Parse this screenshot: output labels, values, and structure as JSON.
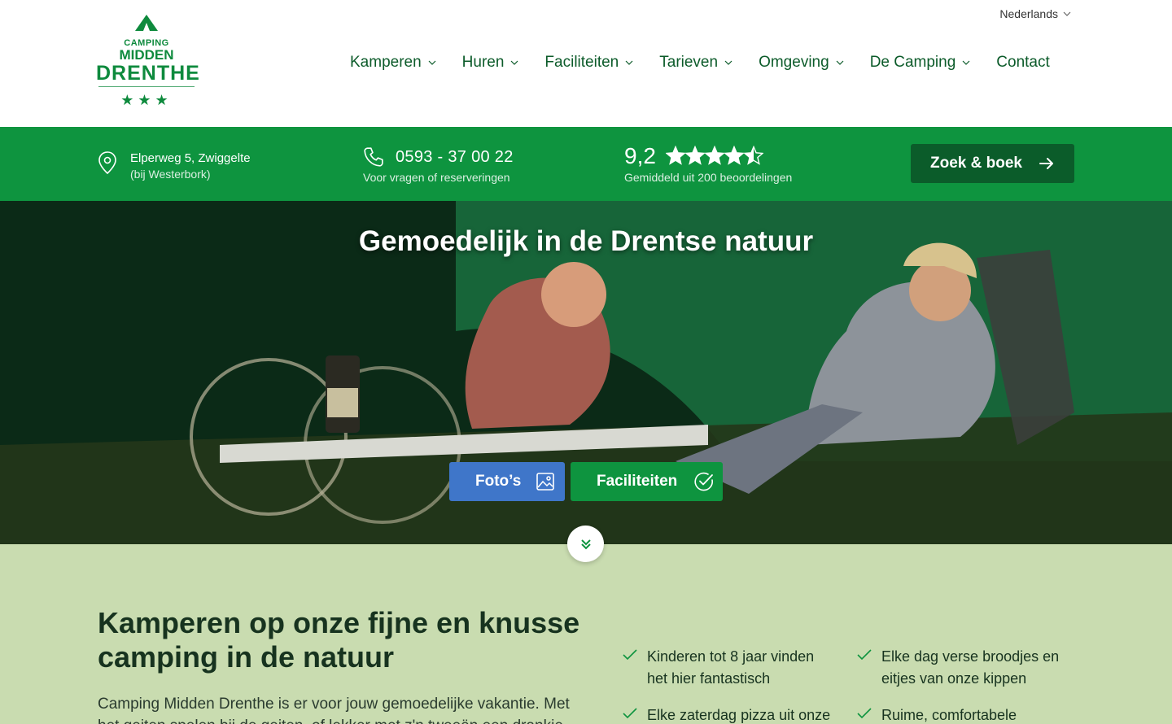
{
  "colors": {
    "brand_green": "#0e943f",
    "dark_green": "#0b5c2a",
    "photo_blue": "#3f76c9",
    "content_bg": "#c9dcb0"
  },
  "logo": {
    "line1": "CAMPING",
    "line2": "MIDDEN",
    "line3": "DRENTHE",
    "stars": "★★★"
  },
  "language": {
    "current": "Nederlands",
    "icon": "chevron-down-icon"
  },
  "nav": {
    "items": [
      {
        "label": "Kamperen",
        "dropdown": true
      },
      {
        "label": "Huren",
        "dropdown": true
      },
      {
        "label": "Faciliteiten",
        "dropdown": true
      },
      {
        "label": "Tarieven",
        "dropdown": true
      },
      {
        "label": "Omgeving",
        "dropdown": true
      },
      {
        "label": "De Camping",
        "dropdown": true
      },
      {
        "label": "Contact",
        "dropdown": false
      }
    ]
  },
  "info": {
    "address_line1": "Elperweg 5, Zwiggelte",
    "address_line2": "(bij Westerbork)",
    "phone": "0593 - 37 00 22",
    "phone_sub": "Voor vragen of reserveringen",
    "rating_score": "9,2",
    "rating_stars": 4.5,
    "rating_sub": "Gemiddeld uit 200 beoordelingen",
    "book_label": "Zoek & boek"
  },
  "hero": {
    "title": "Gemoedelijk in de Drentse natuur",
    "photos_label": "Foto’s",
    "facilities_label": "Faciliteiten"
  },
  "intro": {
    "title": "Kamperen op onze fijne en knusse camping in de natuur",
    "text": "Camping Midden Drenthe is er voor jouw gemoedelijke vakantie. Met het geiten spelen bij de geiten, of lekker met z'n tweeën een drankje"
  },
  "usps": [
    "Kinderen tot 8 jaar vinden het hier fantastisch",
    "Elke dag verse broodjes en eitjes van onze kippen",
    "Elke zaterdag pizza uit onze",
    "Ruime, comfortabele"
  ]
}
